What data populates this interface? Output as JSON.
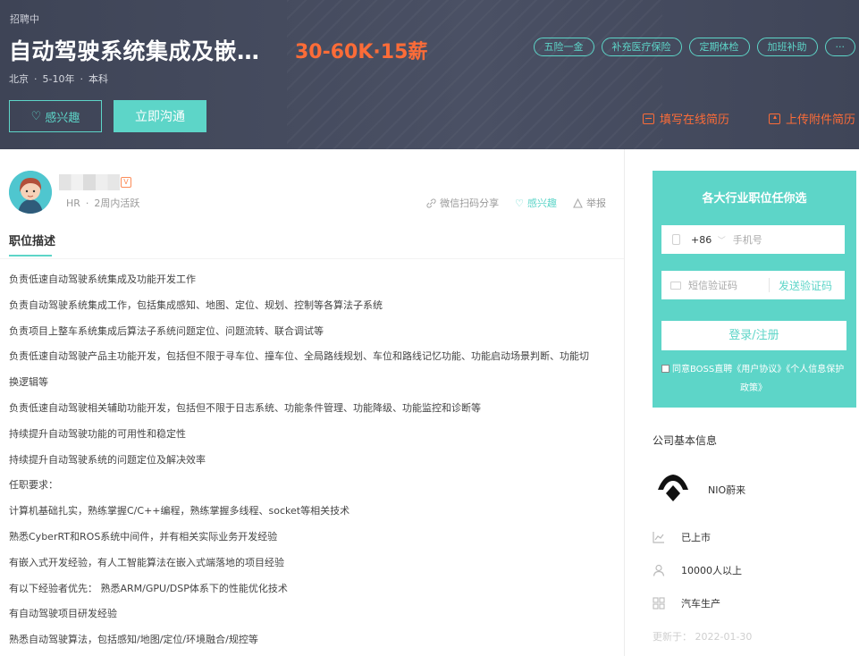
{
  "header": {
    "status": "招聘中",
    "title": "自动驾驶系统集成及嵌…",
    "salary": "30-60K·15薪",
    "meta": {
      "city": "北京",
      "experience": "5-10年",
      "degree": "本科"
    },
    "benefits": [
      "五险一金",
      "补充医疗保险",
      "定期体检",
      "加班补助",
      "···"
    ],
    "interest_button": "感兴趣",
    "chat_button": "立即沟通",
    "fill_resume": "填写在线简历",
    "upload_resume": "上传附件简历"
  },
  "hr": {
    "role": "HR",
    "activity": "2周内活跃",
    "verified_badge": "V"
  },
  "actions": {
    "share": "微信扫码分享",
    "interest": "感兴趣",
    "report": "举报"
  },
  "description": {
    "title": "职位描述",
    "lines": [
      "负责低速自动驾驶系统集成及功能开发工作",
      "负责自动驾驶系统集成工作，包括集成感知、地图、定位、规划、控制等各算法子系统",
      "负责项目上整车系统集成后算法子系统问题定位、问题流转、联合调试等",
      "负责低速自动驾驶产品主功能开发，包括但不限于寻车位、撞车位、全局路线规划、车位和路线记忆功能、功能启动场景判断、功能切",
      "换逻辑等",
      "负责低速自动驾驶相关辅助功能开发，包括但不限于日志系统、功能条件管理、功能降级、功能监控和诊断等",
      "持续提升自动驾驶功能的可用性和稳定性",
      "持续提升自动驾驶系统的问题定位及解决效率",
      "任职要求：",
      "计算机基础扎实，熟练掌握C/C++编程，熟练掌握多线程、socket等相关技术",
      "熟悉CyberRT和ROS系统中间件，并有相关实际业务开发经验",
      "有嵌入式开发经验，有人工智能算法在嵌入式端落地的项目经验",
      "有以下经验者优先：  熟悉ARM/GPU/DSP体系下的性能优化技术",
      "有自动驾驶项目研发经验",
      "熟悉自动驾驶算法，包括感知/地图/定位/环境融合/规控等"
    ]
  },
  "signup": {
    "title": "各大行业职位任你选",
    "country_code": "+86",
    "phone_placeholder": "手机号",
    "code_placeholder": "短信验证码",
    "send_code": "发送验证码",
    "login_button": "登录/注册",
    "agree_text": "同意BOSS直聘《用户协议》《个人信息保护",
    "agree_text_2": "政策》"
  },
  "company": {
    "section_title": "公司基本信息",
    "name": "NIO蔚来",
    "stage": "已上市",
    "size": "10000人以上",
    "industry": "汽车生产",
    "updated": "更新于：  2022-01-30"
  },
  "colors": {
    "accent": "#5dd5c8",
    "salary": "#fc6c38",
    "header_bg": "#464b5e"
  }
}
